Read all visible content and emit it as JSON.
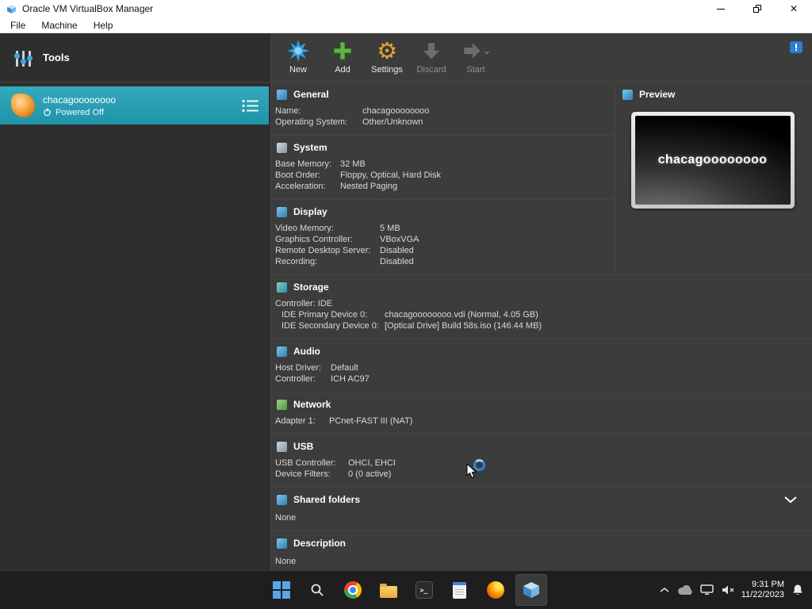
{
  "colors": {
    "selection_teal": "#2aa0b4",
    "titlebar_bg": "#ffffff",
    "panel_bg": "#3c3c3c",
    "sidebar_bg": "#2e2e2e",
    "taskbar_bg": "#1e1e1e",
    "accent_blue": "#2e86de"
  },
  "icons": {
    "settings_gear": "⚙",
    "terminal": ">_",
    "close": "✕"
  },
  "window": {
    "title": "Oracle VM VirtualBox Manager",
    "menu": [
      "File",
      "Machine",
      "Help"
    ]
  },
  "sidebar": {
    "tools_label": "Tools",
    "vm": {
      "name": "chacagoooooooo",
      "status": "Powered Off"
    }
  },
  "toolbar": {
    "new": "New",
    "add": "Add",
    "settings": "Settings",
    "discard": "Discard",
    "start": "Start"
  },
  "details": {
    "general": {
      "title": "General",
      "rows": [
        {
          "label": "Name:",
          "value": "chacagoooooooo"
        },
        {
          "label": "Operating System:",
          "value": "Other/Unknown"
        }
      ]
    },
    "system": {
      "title": "System",
      "rows": [
        {
          "label": "Base Memory:",
          "value": "32 MB"
        },
        {
          "label": "Boot Order:",
          "value": "Floppy, Optical, Hard Disk"
        },
        {
          "label": "Acceleration:",
          "value": "Nested Paging"
        }
      ]
    },
    "display": {
      "title": "Display",
      "rows": [
        {
          "label": "Video Memory:",
          "value": "5 MB"
        },
        {
          "label": "Graphics Controller:",
          "value": "VBoxVGA"
        },
        {
          "label": "Remote Desktop Server:",
          "value": "Disabled"
        },
        {
          "label": "Recording:",
          "value": "Disabled"
        }
      ]
    },
    "storage": {
      "title": "Storage",
      "rows": [
        {
          "label": "Controller: IDE",
          "value": ""
        },
        {
          "label": "IDE Primary Device 0:",
          "value": "chacagoooooooo.vdi (Normal, 4.05 GB)"
        },
        {
          "label": "IDE Secondary Device 0:",
          "value": "[Optical Drive] Build 58s.iso (146.44 MB)"
        }
      ]
    },
    "audio": {
      "title": "Audio",
      "rows": [
        {
          "label": "Host Driver:",
          "value": "Default"
        },
        {
          "label": "Controller:",
          "value": "ICH AC97"
        }
      ]
    },
    "network": {
      "title": "Network",
      "rows": [
        {
          "label": "Adapter 1:",
          "value": "PCnet-FAST III (NAT)"
        }
      ]
    },
    "usb": {
      "title": "USB",
      "rows": [
        {
          "label": "USB Controller:",
          "value": "OHCI, EHCI"
        },
        {
          "label": "Device Filters:",
          "value": "0 (0 active)"
        }
      ]
    },
    "shared_folders": {
      "title": "Shared folders",
      "none": "None"
    },
    "description": {
      "title": "Description",
      "none": "None"
    }
  },
  "preview": {
    "title": "Preview",
    "screen_text": "chacagoooooooo"
  },
  "taskbar": {
    "time": "9:31 PM",
    "date": "11/22/2023"
  }
}
